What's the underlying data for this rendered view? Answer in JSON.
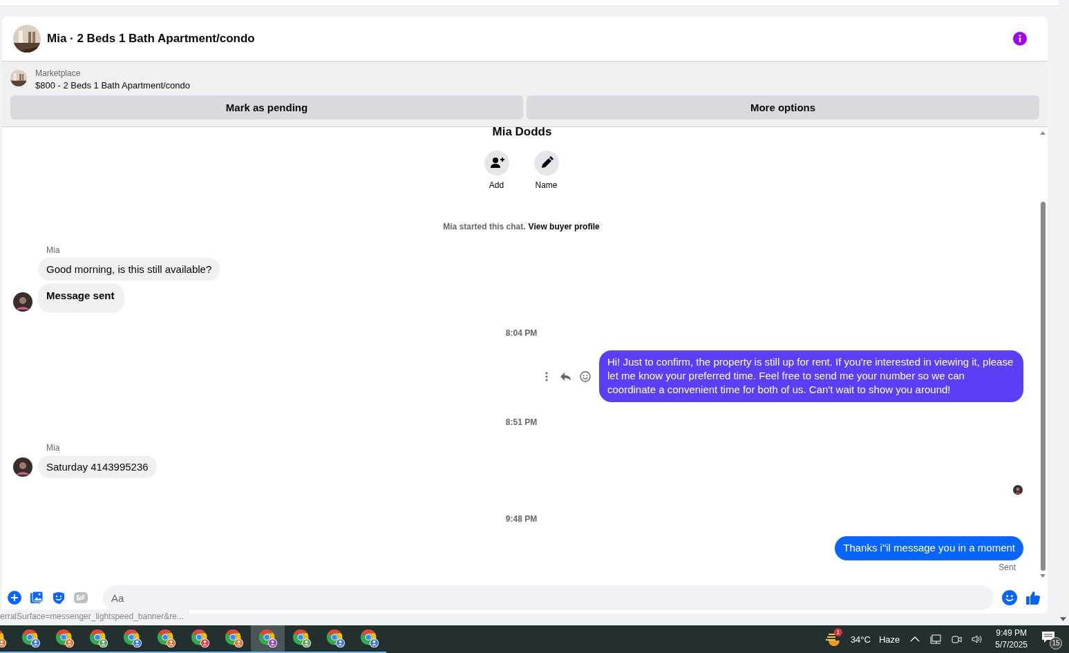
{
  "header": {
    "title": "Mia · 2 Beds 1 Bath Apartment/condo"
  },
  "listing": {
    "label": "Marketplace",
    "title": "$800 - 2 Beds 1 Bath Apartment/condo"
  },
  "actions": [
    "Mark as pending",
    "More options"
  ],
  "profile": {
    "name": "Mia Dodds",
    "buttons": [
      {
        "kind": "add",
        "label": "Add"
      },
      {
        "kind": "edit",
        "label": "Name"
      }
    ]
  },
  "notice": {
    "text": "Mia started this chat.",
    "link": "View buyer profile"
  },
  "messages": [
    {
      "kind": "incoming",
      "sender": "Mia",
      "bubbles": [
        {
          "text": "Good morning, is this still available?",
          "bold": false
        },
        {
          "text": "Message sent",
          "bold": true
        }
      ]
    },
    {
      "kind": "time",
      "text": "8:04 PM"
    },
    {
      "kind": "outgoing",
      "text": "Hi! Just to confirm, the property is still up for rent. If you're interested in viewing it, please let me know your preferred time. Feel free to send me your number so we can coordinate a convenient time for both of us. Can't wait to show you around!",
      "color": "#5b3ff6",
      "hover": true
    },
    {
      "kind": "time",
      "text": "8:51 PM"
    },
    {
      "kind": "incoming",
      "sender": "Mia",
      "bubbles": [
        {
          "text": "Saturday 4143995236",
          "bold": false
        }
      ]
    },
    {
      "kind": "seen"
    },
    {
      "kind": "time",
      "text": "9:48 PM"
    },
    {
      "kind": "outgoing",
      "text": "Thanks i\"il message you in a moment",
      "color": "#0866ff",
      "hover": false,
      "status": "Sent"
    }
  ],
  "composer": {
    "placeholder": "Aa"
  },
  "status_url": "erralSurface=messenger_lightspeed_banner&re...",
  "taskbar": {
    "apps": [
      {
        "color": "#e8702a",
        "selected": false
      },
      {
        "color": "#3b78e7",
        "selected": false
      },
      {
        "color": "#e8702a",
        "selected": false
      },
      {
        "color": "#5fa85a",
        "selected": false
      },
      {
        "color": "#3b78e7",
        "selected": false
      },
      {
        "color": "#e8702a",
        "selected": false
      },
      {
        "color": "#e8334a",
        "selected": false
      },
      {
        "color": "#e8702a",
        "selected": false
      },
      {
        "color": "#9b3fd6",
        "selected": true
      },
      {
        "color": "#5fa85a",
        "selected": false
      },
      {
        "color": "#3b78e7",
        "selected": false
      },
      {
        "color": "#3b78e7",
        "selected": false
      }
    ],
    "weather_badge": "1",
    "temperature": "34°C",
    "weather": "Haze",
    "time": "9:49 PM",
    "date": "5/7/2025",
    "notifications": "15"
  }
}
